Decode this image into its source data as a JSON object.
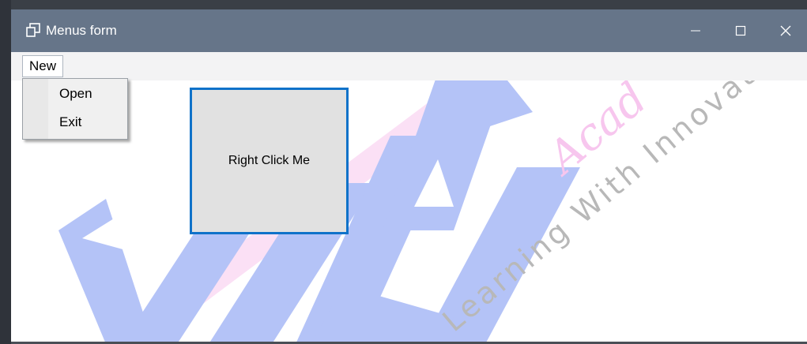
{
  "window": {
    "title": "Menus form",
    "icon": "form-window-icon",
    "controls": {
      "minimize": "minimize-icon",
      "maximize": "maximize-icon",
      "close": "close-icon"
    }
  },
  "menu": {
    "items": [
      {
        "label": "New"
      }
    ],
    "dropdown": {
      "items": [
        {
          "label": "Open"
        },
        {
          "label": "Exit"
        }
      ]
    }
  },
  "main": {
    "context_target_label": "Right Click Me"
  },
  "watermark": {
    "tagline": "Learning With Innovation",
    "brand_script": "Academy"
  },
  "colors": {
    "titlebar": "#667589",
    "accent_border": "#0f72c9",
    "watermark_blue": "#b4c3f7",
    "watermark_pink": "#fbe0f5"
  }
}
